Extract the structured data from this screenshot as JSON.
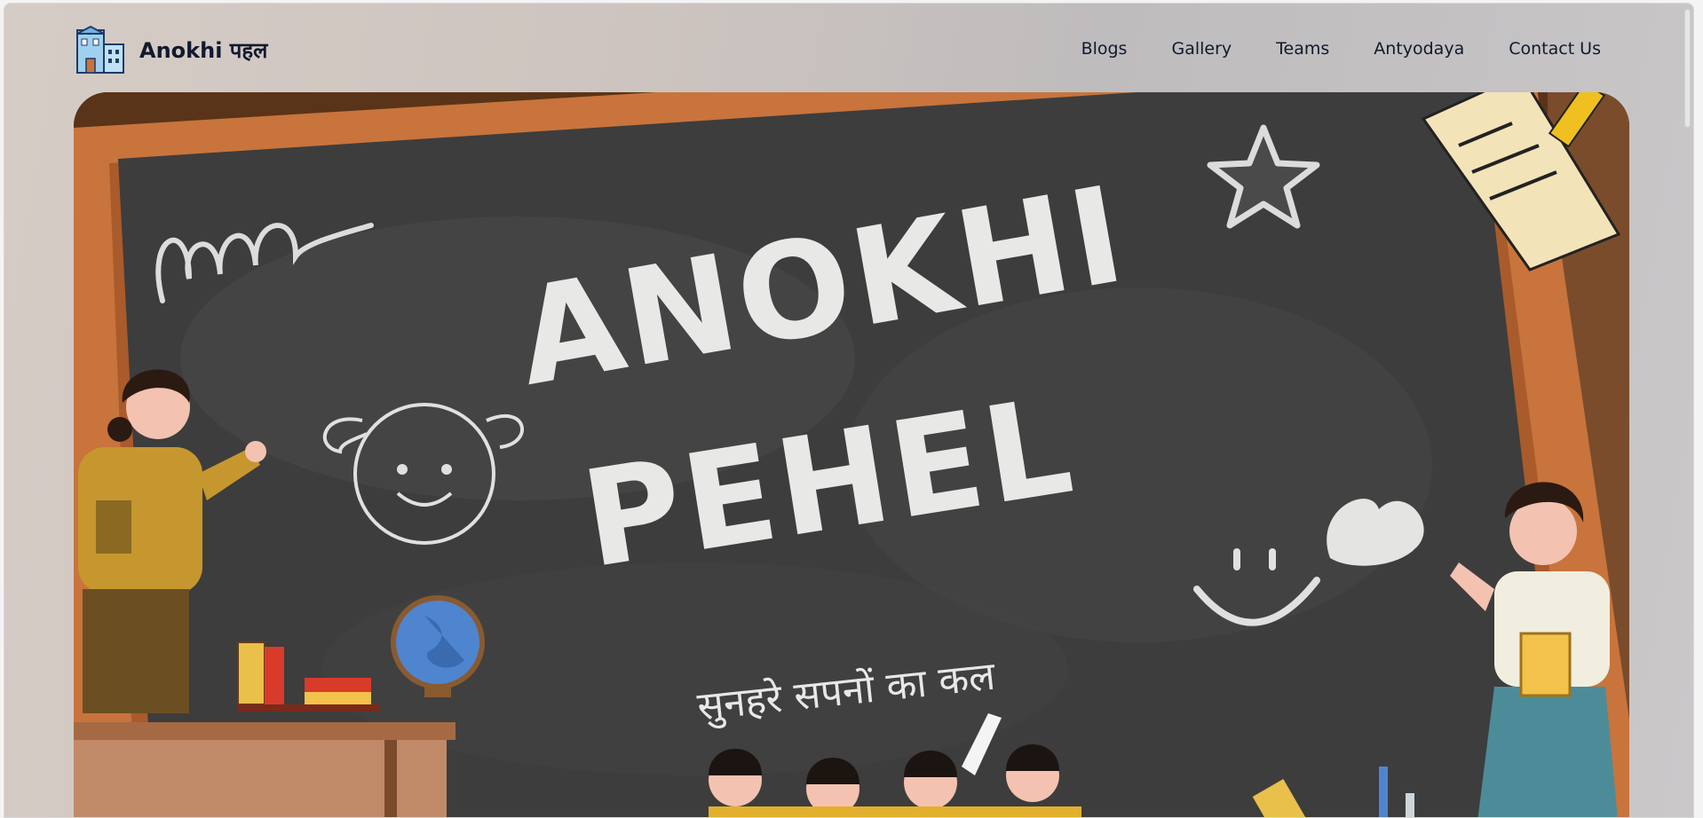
{
  "brand": {
    "name": "Anokhi पहल",
    "logo_icon": "school-building-icon"
  },
  "nav": {
    "items": [
      {
        "label": "Blogs"
      },
      {
        "label": "Gallery"
      },
      {
        "label": "Teams"
      },
      {
        "label": "Antyodaya"
      },
      {
        "label": "Contact Us"
      }
    ]
  },
  "hero": {
    "title_line1": "ANOKHI",
    "title_line2": "PEHEL",
    "tagline": "सुनहरे सपनों का कल"
  },
  "colors": {
    "frame_wood": "#c8743c",
    "chalkboard": "#3d3d3d",
    "chalk": "#e8e8e6",
    "text_dark": "#111a2e"
  }
}
